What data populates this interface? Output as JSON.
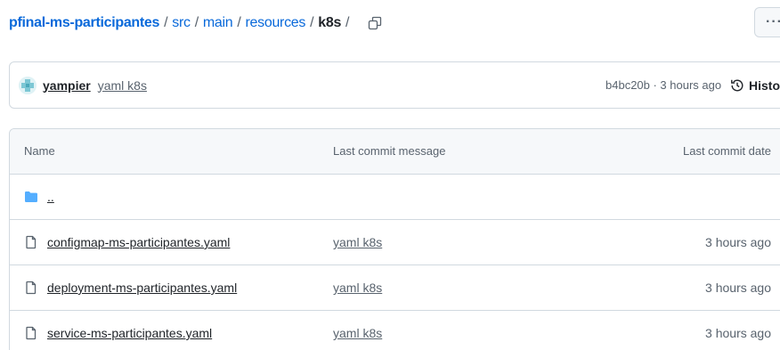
{
  "breadcrumb": {
    "repo": "pfinal-ms-participantes",
    "segments": [
      "src",
      "main",
      "resources"
    ],
    "current": "k8s",
    "separator": "/"
  },
  "more_button": "···",
  "latest_commit": {
    "author": "yampier",
    "message": "yaml k8s",
    "sha_time": "b4bc20b · 3 hours ago",
    "history_label": "History"
  },
  "table": {
    "headers": {
      "name": "Name",
      "message": "Last commit message",
      "date": "Last commit date"
    },
    "parent": "..",
    "files": [
      {
        "name": "configmap-ms-participantes.yaml",
        "message": "yaml k8s",
        "date": "3 hours ago"
      },
      {
        "name": "deployment-ms-participantes.yaml",
        "message": "yaml k8s",
        "date": "3 hours ago"
      },
      {
        "name": "service-ms-participantes.yaml",
        "message": "yaml k8s",
        "date": "3 hours ago"
      }
    ]
  },
  "colors": {
    "link": "#0969da",
    "folder": "#54aeff",
    "border": "#d1d9e0",
    "muted": "#59636e",
    "header_bg": "#f6f8fa"
  }
}
